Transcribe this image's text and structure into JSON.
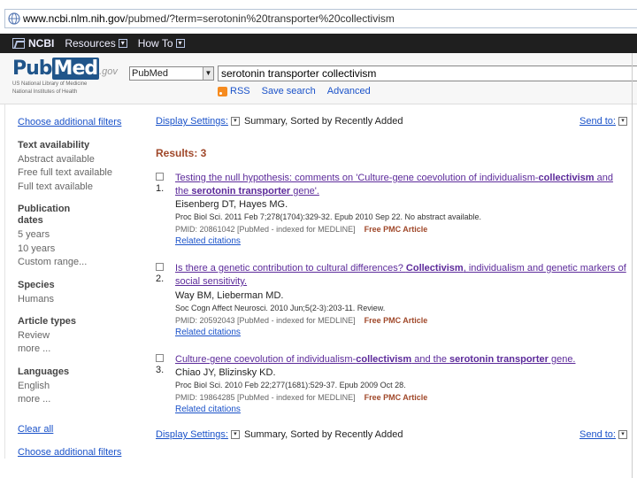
{
  "browser": {
    "url_host": "www.ncbi.nlm.nih.gov",
    "url_path": "/pubmed/?term=serotonin%20transporter%20collectivism"
  },
  "ncbi_bar": {
    "logo": "NCBI",
    "resources": "Resources",
    "howto": "How To"
  },
  "header": {
    "logo_pub": "Pub",
    "logo_med": "Med",
    "logo_gov": ".gov",
    "logo_sub1": "US National Library of Medicine",
    "logo_sub2": "National Institutes of Health",
    "database": "PubMed",
    "search_value": "serotonin transporter collectivism",
    "rss": "RSS",
    "save_search": "Save search",
    "advanced": "Advanced"
  },
  "sidebar": {
    "choose_filters_top": "Choose additional filters",
    "text_availability": "Text availability",
    "abstract_available": "Abstract available",
    "free_full_text": "Free full text available",
    "full_text": "Full text available",
    "publication_dates_1": "Publication",
    "publication_dates_2": "dates",
    "five_years": "5 years",
    "ten_years": "10 years",
    "custom_range": "Custom range...",
    "species": "Species",
    "humans": "Humans",
    "article_types": "Article types",
    "review": "Review",
    "more1": "more ...",
    "languages": "Languages",
    "english": "English",
    "more2": "more ...",
    "clear_all": "Clear all",
    "choose_filters_bottom": "Choose additional filters"
  },
  "main": {
    "display_settings_label": "Display Settings:",
    "display_settings_value": "Summary, Sorted by Recently Added",
    "send_to": "Send to:",
    "results": "Results: 3",
    "items": [
      {
        "num": "1.",
        "title_a": "Testing the null hypothesis: comments on 'Culture-gene coevolution of individualism-",
        "title_b": "collectivism",
        "title_c": " and the ",
        "title_d": "serotonin transporter",
        "title_e": " gene'.",
        "authors": "Eisenberg DT, Hayes MG.",
        "citation": "Proc Biol Sci. 2011 Feb 7;278(1704):329-32. Epub 2010 Sep 22. No abstract available.",
        "pmid": "PMID: 20861042 [PubMed - indexed for MEDLINE]",
        "free": "Free PMC Article",
        "related": "Related citations"
      },
      {
        "num": "2.",
        "title_a": "Is there a genetic contribution to cultural differences? ",
        "title_b": "Collectivism",
        "title_c": ", individualism and genetic markers of social sensitivity.",
        "title_d": "",
        "title_e": "",
        "authors": "Way BM, Lieberman MD.",
        "citation": "Soc Cogn Affect Neurosci. 2010 Jun;5(2-3):203-11. Review.",
        "pmid": "PMID: 20592043 [PubMed - indexed for MEDLINE]",
        "free": "Free PMC Article",
        "related": "Related citations"
      },
      {
        "num": "3.",
        "title_a": "Culture-gene coevolution of individualism-",
        "title_b": "collectivism",
        "title_c": " and the ",
        "title_d": "serotonin transporter",
        "title_e": " gene.",
        "authors": "Chiao JY, Blizinsky KD.",
        "citation": "Proc Biol Sci. 2010 Feb 22;277(1681):529-37. Epub 2009 Oct 28.",
        "pmid": "PMID: 19864285 [PubMed - indexed for MEDLINE]",
        "free": "Free PMC Article",
        "related": "Related citations"
      }
    ]
  }
}
